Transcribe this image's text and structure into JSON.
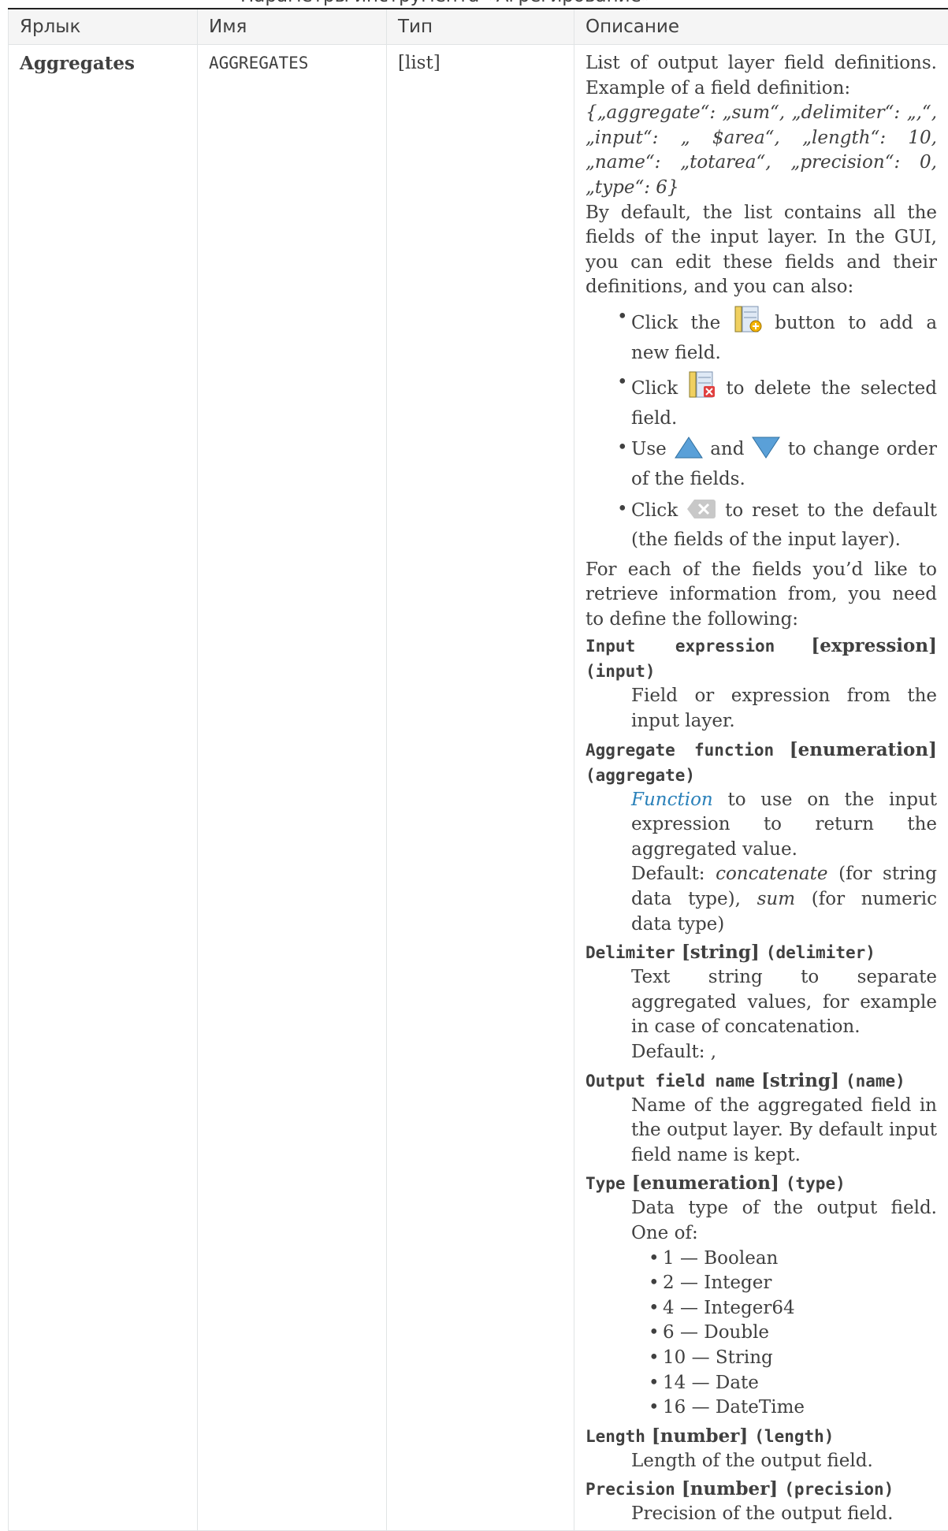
{
  "caption_fragment": "Параметры инструмента «Агрегирование»",
  "headers": {
    "label": "Ярлык",
    "name": "Имя",
    "type": "Тип",
    "description": "Описание"
  },
  "row": {
    "label": "Aggregates",
    "name": "AGGREGATES",
    "type": "[list]",
    "desc_intro": "List of output layer field definitions. Example of a field definition:",
    "desc_example": "{„aggregate“: „sum“, „delimiter“: „,“, „input“: „ $area“, „length“: 10, „name“: „totarea“, „precision“: 0, „type“: 6}",
    "desc_default": "By default, the list contains all the fields of the input layer. In the GUI, you can edit these fields and their definitions, and you can also:",
    "gui_items": [
      {
        "pre": "Click the",
        "post": "button to add a new field.",
        "icon": "add-field-icon"
      },
      {
        "pre": "Click",
        "post": "to delete the selected field.",
        "icon": "delete-field-icon"
      },
      {
        "pre": "Use",
        "mid": "and",
        "post": "to change order of the fields.",
        "icon": "arrow-up-icon",
        "icon2": "arrow-down-icon"
      },
      {
        "pre": "Click",
        "post": "to reset to the default (the fields of the input layer).",
        "icon": "clear-icon"
      }
    ],
    "desc_following": "For each of the fields you’d like to retrieve information from, you need to define the following:",
    "fields": {
      "input": {
        "term": "Input expression",
        "type": "[expression]",
        "key": "(input)",
        "text": "Field or expression from the input layer."
      },
      "aggregate": {
        "term": "Aggregate function",
        "type": "[enumeration]",
        "key": "(aggregate)",
        "link": "Function",
        "text": "to use on the input expression to return the aggregated value.",
        "default_pre": "Default:",
        "default_a": "concatenate",
        "default_mid": "(for string data type),",
        "default_b": "sum",
        "default_post": "(for numeric data type)"
      },
      "delimiter": {
        "term": "Delimiter",
        "type": "[string]",
        "key": "(delimiter)",
        "text": "Text string to separate aggregated values, for example in case of concatenation.",
        "default": "Default: ,"
      },
      "name": {
        "term": "Output field name",
        "type": "[string]",
        "key": "(name)",
        "text": "Name of the aggregated field in the output layer. By default input field name is kept."
      },
      "type": {
        "term": "Type",
        "type": "[enumeration]",
        "key": "(type)",
        "text": "Data type of the output field. One of:",
        "options": [
          "1 — Boolean",
          "2 — Integer",
          "4 — Integer64",
          "6 — Double",
          "10 — String",
          "14 — Date",
          "16 — DateTime"
        ]
      },
      "length": {
        "term": "Length",
        "type": "[number]",
        "key": "(length)",
        "text": "Length of the output field."
      },
      "precision": {
        "term": "Precision",
        "type": "[number]",
        "key": "(precision)",
        "text": "Precision of the output field."
      }
    }
  }
}
